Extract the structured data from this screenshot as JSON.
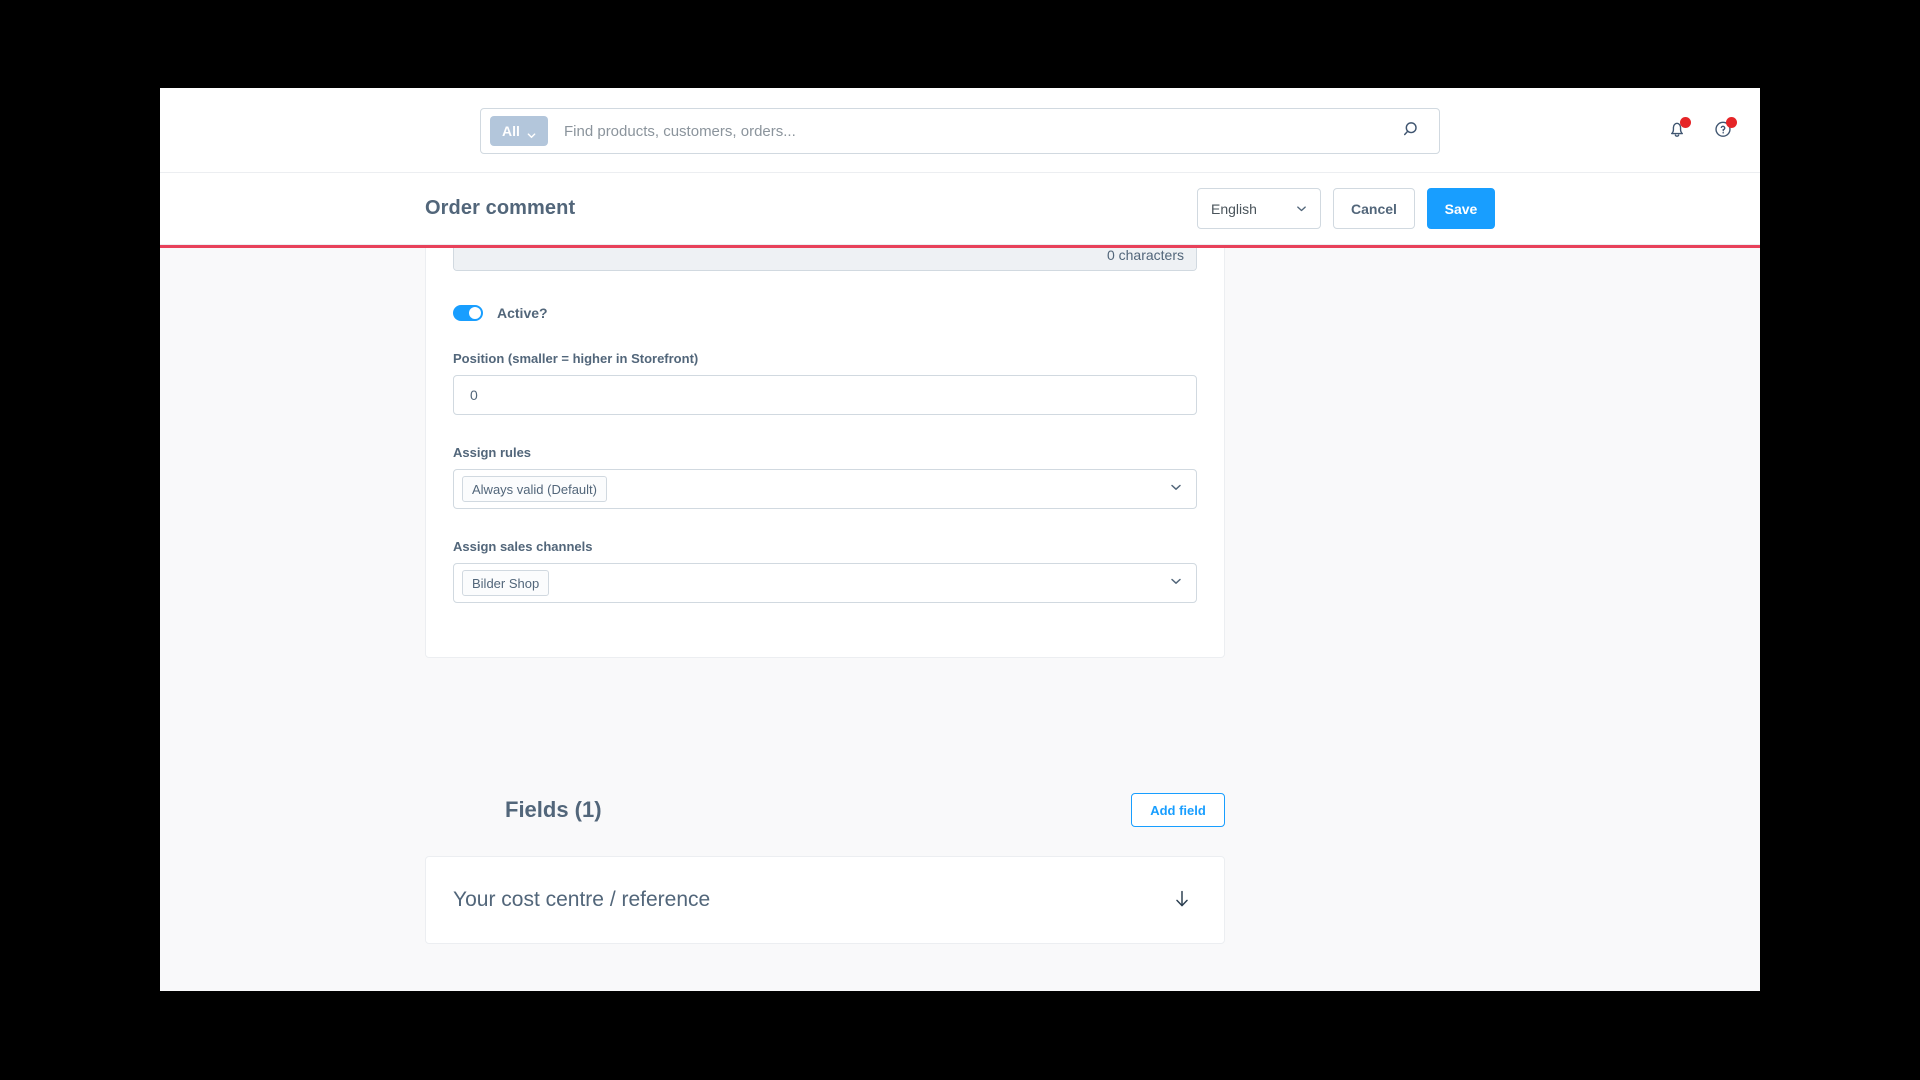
{
  "topbar": {
    "search": {
      "scope_label": "All",
      "placeholder": "Find products, customers, orders...",
      "value": "",
      "scope_icon": "chevron-down-icon",
      "submit_icon": "search-icon"
    },
    "notifications_icon": "bell-icon",
    "help_icon": "question-circle-icon",
    "notifications_has_badge": true,
    "help_has_badge": true
  },
  "smartbar": {
    "title": "Order comment",
    "language": "English",
    "language_icon": "chevron-down-icon",
    "cancel_label": "Cancel",
    "save_label": "Save"
  },
  "loading": {
    "accent_color": "#e8415a"
  },
  "main_card": {
    "character_count": "0 characters",
    "active_label": "Active?",
    "active_on": true,
    "position": {
      "label": "Position (smaller = higher in Storefront)",
      "value": "0"
    },
    "assign_rules": {
      "label": "Assign rules",
      "chips": [
        "Always valid (Default)"
      ],
      "icon": "chevron-down-icon"
    },
    "assign_sales_channels": {
      "label": "Assign sales channels",
      "chips": [
        "Bilder Shop"
      ],
      "icon": "chevron-down-icon"
    }
  },
  "fields_section": {
    "title": "Fields (1)",
    "add_field_label": "Add field",
    "items": [
      {
        "title": "Your cost centre / reference",
        "icon": "arrow-down-icon"
      }
    ]
  },
  "colors": {
    "primary": "#189eff",
    "text": "#52667a",
    "loading_bar": "#e8415a",
    "badge": "#e52427"
  }
}
